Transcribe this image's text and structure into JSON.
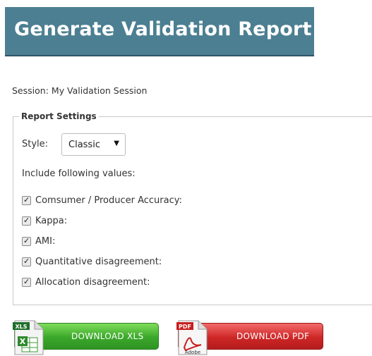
{
  "header": {
    "title": "Generate Validation Report"
  },
  "session": {
    "label": "Session:",
    "name": "My Validation Session"
  },
  "settings": {
    "legend": "Report Settings",
    "style_label": "Style:",
    "style_value": "Classic",
    "include_label": "Include following values:",
    "options": [
      {
        "label": "Comsumer / Producer Accuracy:",
        "checked": true
      },
      {
        "label": "Kappa:",
        "checked": true
      },
      {
        "label": "AMI:",
        "checked": true
      },
      {
        "label": "Quantitative disagreement:",
        "checked": true
      },
      {
        "label": "Allocation disagreement:",
        "checked": true
      }
    ]
  },
  "downloads": {
    "xls_label": "DOWNLOAD XLS",
    "xls_icon_text": "XLS",
    "pdf_label": "DOWNLOAD PDF",
    "pdf_icon_text": "PDF",
    "pdf_icon_brand": "Adobe"
  },
  "colors": {
    "title_bg": "#4c7f92",
    "xls_green": "#3aa72a",
    "pdf_red": "#cf2727"
  },
  "icons": {
    "style_arrow": "caret-down-icon",
    "xls": "excel-file-icon",
    "pdf": "pdf-file-icon"
  }
}
